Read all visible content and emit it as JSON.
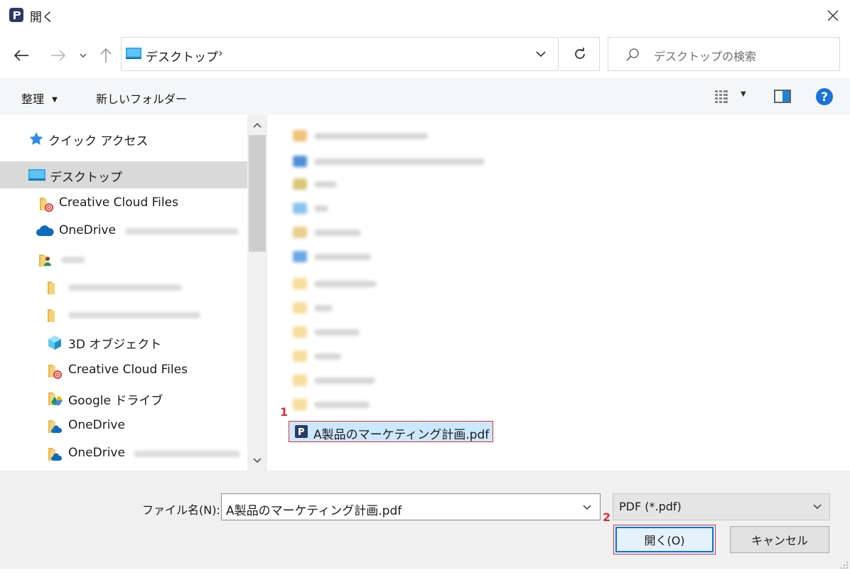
{
  "window": {
    "title": "開く"
  },
  "address": {
    "location": "デスクトップ",
    "separator": "›"
  },
  "search": {
    "placeholder": "デスクトップの検索"
  },
  "toolbar": {
    "organize_label": "整理",
    "new_folder_label": "新しいフォルダー"
  },
  "nav": {
    "items": [
      {
        "label": "クイック アクセス",
        "icon": "star-icon"
      },
      {
        "label": "デスクトップ",
        "icon": "desktop-icon",
        "selected": true
      },
      {
        "label": "Creative Cloud Files",
        "icon": "creative-cloud-folder-icon"
      },
      {
        "label": "OneDrive",
        "icon": "onedrive-cloud-icon"
      },
      {
        "label": "",
        "icon": "user-folder-icon"
      },
      {
        "label": "",
        "icon": "folder-icon"
      },
      {
        "label": "",
        "icon": "folder-icon"
      },
      {
        "label": "3D オブジェクト",
        "icon": "3d-objects-icon"
      },
      {
        "label": "Creative Cloud Files",
        "icon": "creative-cloud-folder-icon"
      },
      {
        "label": "Google ドライブ",
        "icon": "google-drive-icon"
      },
      {
        "label": "OneDrive",
        "icon": "onedrive-folder-icon"
      },
      {
        "label": "OneDrive",
        "icon": "onedrive-folder-icon"
      }
    ]
  },
  "files": {
    "selected_file": "A製品のマーケティング計画.pdf"
  },
  "annotations": {
    "marker_1": "1",
    "marker_2": "2"
  },
  "bottom": {
    "filename_label": "ファイル名(N):",
    "filename_value": "A製品のマーケティング計画.pdf",
    "filetype_value": "PDF (*.pdf)",
    "open_label": "開く(O)",
    "cancel_label": "キャンセル"
  },
  "colors": {
    "accent": "#0078d7",
    "selection": "#cce8ff",
    "highlight": "#d9313a",
    "app": "#2b3a67"
  }
}
